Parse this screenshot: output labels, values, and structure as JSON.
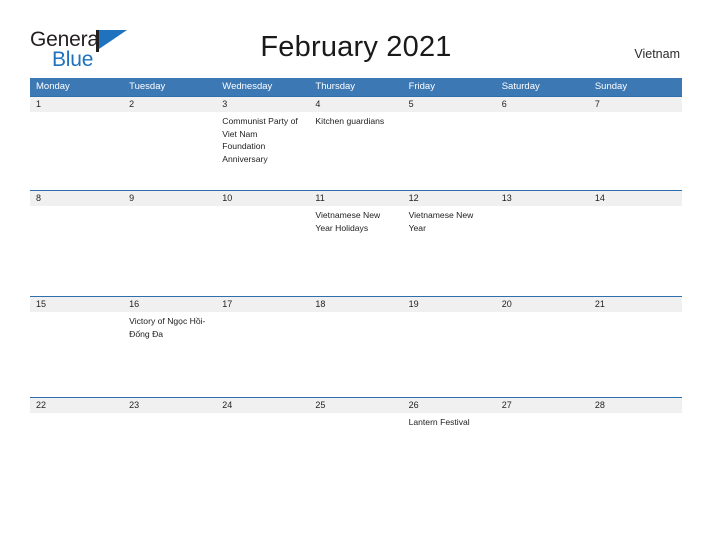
{
  "brand": {
    "name_part1": "General",
    "name_part2": "Blue",
    "flag_icon": "blue-triangle-flag-icon",
    "color_dark": "#231f20",
    "color_blue": "#1f72bd"
  },
  "header": {
    "title": "February 2021",
    "country": "Vietnam"
  },
  "theme": {
    "header_blue": "#3c78b4",
    "row_divider_blue": "#2f6fad",
    "date_strip_gray": "#f0f0f0",
    "text_color": "#222222"
  },
  "calendar": {
    "month": "February",
    "year": "2021",
    "weekday_headers": [
      "Monday",
      "Tuesday",
      "Wednesday",
      "Thursday",
      "Friday",
      "Saturday",
      "Sunday"
    ],
    "weeks": [
      {
        "days": [
          {
            "date": "1",
            "events": []
          },
          {
            "date": "2",
            "events": []
          },
          {
            "date": "3",
            "events": [
              "Communist Party of Viet Nam Foundation Anniversary"
            ]
          },
          {
            "date": "4",
            "events": [
              "Kitchen guardians"
            ]
          },
          {
            "date": "5",
            "events": []
          },
          {
            "date": "6",
            "events": []
          },
          {
            "date": "7",
            "events": []
          }
        ]
      },
      {
        "days": [
          {
            "date": "8",
            "events": []
          },
          {
            "date": "9",
            "events": []
          },
          {
            "date": "10",
            "events": []
          },
          {
            "date": "11",
            "events": [
              "Vietnamese New Year Holidays"
            ]
          },
          {
            "date": "12",
            "events": [
              "Vietnamese New Year"
            ]
          },
          {
            "date": "13",
            "events": []
          },
          {
            "date": "14",
            "events": []
          }
        ]
      },
      {
        "days": [
          {
            "date": "15",
            "events": []
          },
          {
            "date": "16",
            "events": [
              "Victory of Ngọc Hồi-Đống Đa"
            ]
          },
          {
            "date": "17",
            "events": []
          },
          {
            "date": "18",
            "events": []
          },
          {
            "date": "19",
            "events": []
          },
          {
            "date": "20",
            "events": []
          },
          {
            "date": "21",
            "events": []
          }
        ]
      },
      {
        "days": [
          {
            "date": "22",
            "events": []
          },
          {
            "date": "23",
            "events": []
          },
          {
            "date": "24",
            "events": []
          },
          {
            "date": "25",
            "events": []
          },
          {
            "date": "26",
            "events": [
              "Lantern Festival"
            ]
          },
          {
            "date": "27",
            "events": []
          },
          {
            "date": "28",
            "events": []
          }
        ]
      }
    ]
  }
}
